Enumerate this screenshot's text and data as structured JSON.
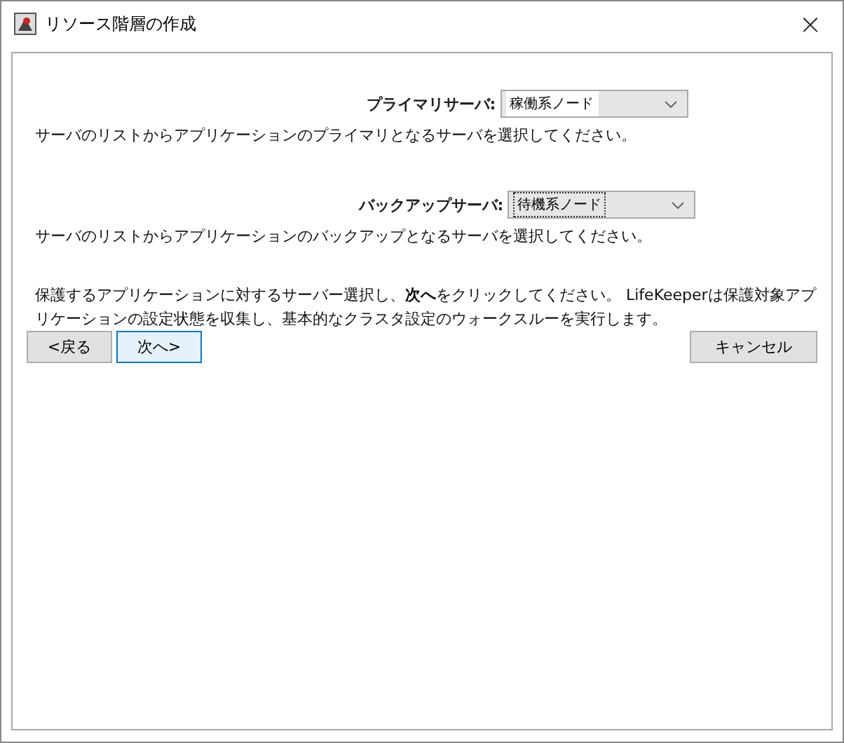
{
  "window": {
    "title": "リソース階層の作成",
    "close": "×"
  },
  "servers": [
    {
      "label": "プライマリサーバ:",
      "value": "稼働系ノード",
      "focused": false,
      "description": "サーバのリストからアプリケーションのプライマリとなるサーバを選択してください。"
    },
    {
      "label": "バックアップサーバ:",
      "value": "待機系ノード",
      "focused": true,
      "description": "サーバのリストからアプリケーションのバックアップとなるサーバを選択してください。"
    }
  ],
  "instructions": "保護するアプリケーションに対するサーバー選択し、**次へ**をクリックしてください。 LifeKeeperは保護対象アプリケーションの設定状態を収集し、基本的なクラスタ設定のウォークスルーを実行します。",
  "buttons": [
    {
      "label": "<戻る",
      "default": false
    },
    {
      "label": "次へ>",
      "default": true
    }
  ],
  "cancel_button": "キャンセル"
}
